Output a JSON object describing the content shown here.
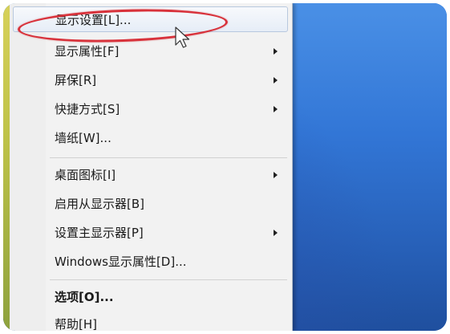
{
  "menu": {
    "items": [
      {
        "label": "显示设置[L]...",
        "submenu": false,
        "bold": false,
        "hover": true
      },
      {
        "label": "显示属性[F]",
        "submenu": true,
        "bold": false
      },
      {
        "label": "屏保[R]",
        "submenu": true,
        "bold": false
      },
      {
        "label": "快捷方式[S]",
        "submenu": true,
        "bold": false
      },
      {
        "label": "墙纸[W]...",
        "submenu": false,
        "bold": false
      },
      {
        "label": "桌面图标[I]",
        "submenu": true,
        "bold": false
      },
      {
        "label": "启用从显示器[B]",
        "submenu": false,
        "bold": false
      },
      {
        "label": "设置主显示器[P]",
        "submenu": true,
        "bold": false
      },
      {
        "label": "Windows显示属性[D]...",
        "submenu": false,
        "bold": false
      },
      {
        "label": "选项[O]...",
        "submenu": false,
        "bold": true
      },
      {
        "label": "帮助[H]",
        "submenu": false,
        "bold": false
      }
    ]
  },
  "annotation": {
    "color": "#d8323b"
  },
  "desktop": {
    "color": "#3276d6"
  }
}
